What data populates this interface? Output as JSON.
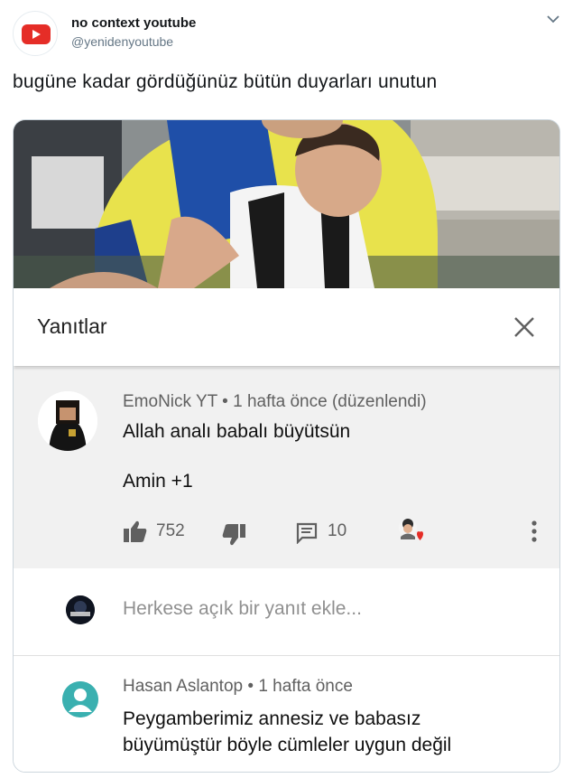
{
  "tweet": {
    "author_name": "no context youtube",
    "author_handle": "@yenidenyoutube",
    "text": "bugüne kadar gördüğünüz bütün duyarları unutun"
  },
  "replies_panel": {
    "title": "Yanıtlar",
    "comment": {
      "author": "EmoNick YT",
      "time": "1 hafta önce (düzenlendi)",
      "line1": "Allah analı babalı büyütsün",
      "line2": "Amin +1",
      "likes": "752",
      "replies": "10"
    },
    "add_reply_placeholder": "Herkese açık bir yanıt ekle...",
    "reply": {
      "author": "Hasan Aslantop",
      "time": "1 hafta önce",
      "text_line1": "Peygamberimiz annesiz ve babasız",
      "text_line2": "büyümüştür böyle cümleler uygun değil"
    }
  },
  "colors": {
    "youtube_red": "#e52d27",
    "panel_gray": "#f1f1f1",
    "meta_gray": "#606060"
  },
  "icons": [
    "youtube-logo-icon",
    "chevron-down-icon",
    "close-icon",
    "like-icon",
    "dislike-icon",
    "comment-icon",
    "more-vert-icon",
    "creator-heart-icon"
  ]
}
